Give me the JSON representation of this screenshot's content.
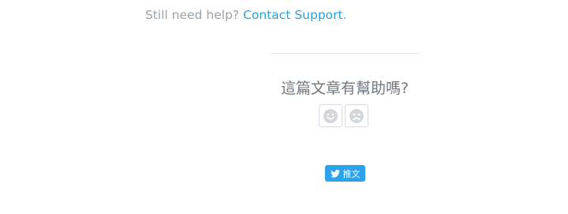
{
  "help": {
    "prefix": "Still need help?",
    "link_label": "Contact Support",
    "suffix": "."
  },
  "feedback": {
    "question": "這篇文章有幫助嗎?",
    "upvote_icon": "smiley-face-icon",
    "downvote_icon": "frowny-face-icon"
  },
  "share": {
    "tweet_label": "推文",
    "icon": "twitter-bird-icon"
  },
  "colors": {
    "link": "#2f9fd8",
    "muted_text": "#9aa2aa",
    "tweet_button": "#2aa3ef"
  }
}
